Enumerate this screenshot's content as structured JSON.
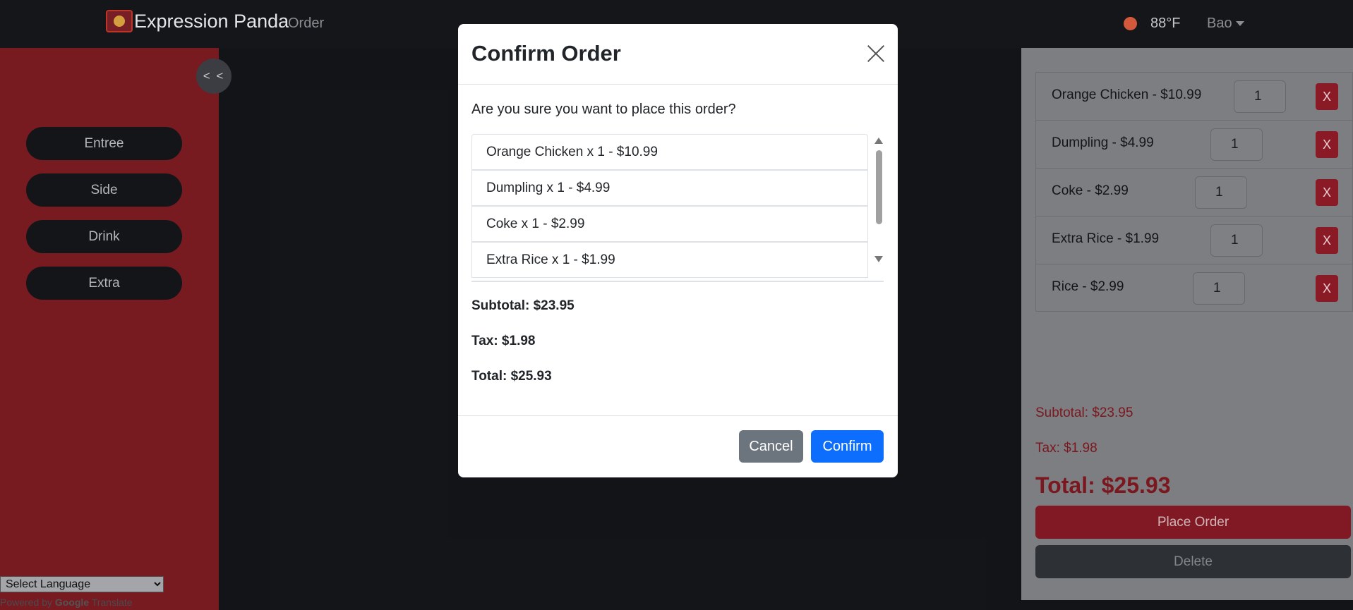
{
  "navbar": {
    "brand": "Expression Panda",
    "order_link": "Order",
    "temperature": "88°F",
    "user": "Bao",
    "status_color": "#d85b3f"
  },
  "sidebar": {
    "collapse_label": "< <",
    "categories": [
      "Entree",
      "Side",
      "Drink",
      "Extra"
    ],
    "language_select": "Select Language",
    "powered_by": "Powered by",
    "google": "Google",
    "translate": "Translate"
  },
  "cart": {
    "items": [
      {
        "name": "Orange Chicken - $10.99",
        "qty": "1"
      },
      {
        "name": "Dumpling - $4.99",
        "qty": "1"
      },
      {
        "name": "Coke - $2.99",
        "qty": "1"
      },
      {
        "name": "Extra Rice - $1.99",
        "qty": "1"
      },
      {
        "name": "Rice - $2.99",
        "qty": "1"
      }
    ],
    "remove_label": "X",
    "subtotal": "Subtotal: $23.95",
    "tax": "Tax: $1.98",
    "total": "Total: $25.93",
    "place_order": "Place Order",
    "delete": "Delete"
  },
  "modal": {
    "title": "Confirm Order",
    "question": "Are you sure you want to place this order?",
    "items": [
      "Orange Chicken x 1 - $10.99",
      "Dumpling x 1 - $4.99",
      "Coke x 1 - $2.99",
      "Extra Rice x 1 - $1.99"
    ],
    "subtotal": "Subtotal: $23.95",
    "tax": "Tax: $1.98",
    "total": "Total: $25.93",
    "cancel": "Cancel",
    "confirm": "Confirm"
  },
  "colors": {
    "sidebar_red": "#7a1c22",
    "primary_blue": "#0d6efd",
    "secondary_gray": "#6c757d"
  }
}
